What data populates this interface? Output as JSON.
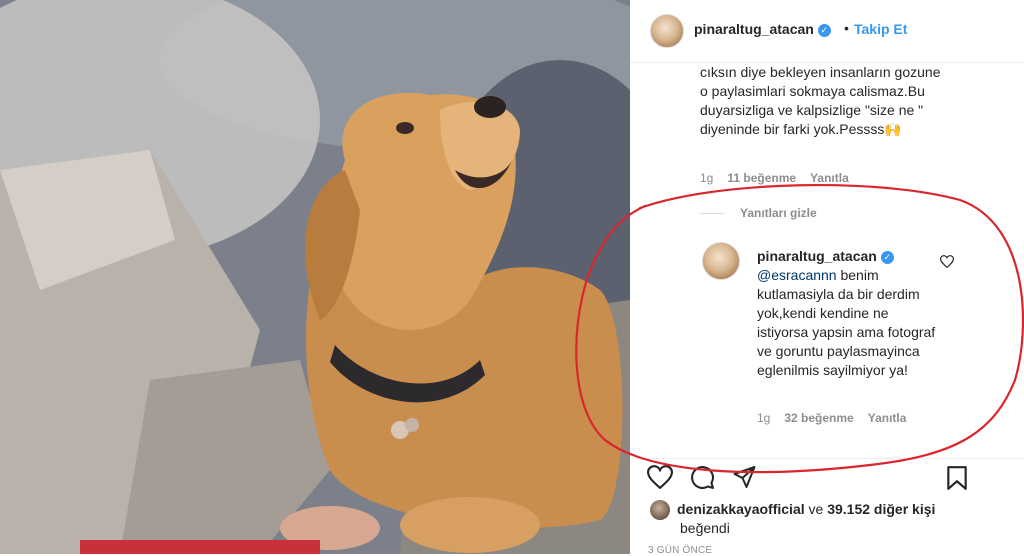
{
  "post": {
    "author": "pinaraltug_atacan",
    "follow_label": "Takip Et",
    "separator": "•"
  },
  "photo": {
    "icon": "dog-photo"
  },
  "comment": {
    "text": "cıksın diye bekleyen insanların gozune o paylasimlari sokmaya calismaz.Bu duyarsizliga ve kalpsizlige \"size ne \" diyeninde bir farki yok.Pessss🙌",
    "time": "1g",
    "likes": "11 beğenme",
    "reply_label": "Yanıtla"
  },
  "hide_replies_label": "Yanıtları gizle",
  "reply": {
    "username": "pinaraltug_atacan",
    "mention": "@esracannn",
    "text": " benim kutlamasiyla da bir derdim yok,kendi kendine ne istiyorsa yapsin ama fotograf ve goruntu paylasmayinca eglenilmis sayilmiyor ya!",
    "time": "1g",
    "likes": "32 beğenme",
    "reply_label": "Yanıtla"
  },
  "likes_line": {
    "user": "denizakkayaofficial",
    "connector": " ve ",
    "others": "39.152 diğer kişi",
    "suffix": "beğendi"
  },
  "timestamp": "3 GÜN ÖNCE",
  "colors": {
    "link": "#3897f0",
    "annotation": "#d9262c",
    "muted": "#8e8e8e"
  }
}
